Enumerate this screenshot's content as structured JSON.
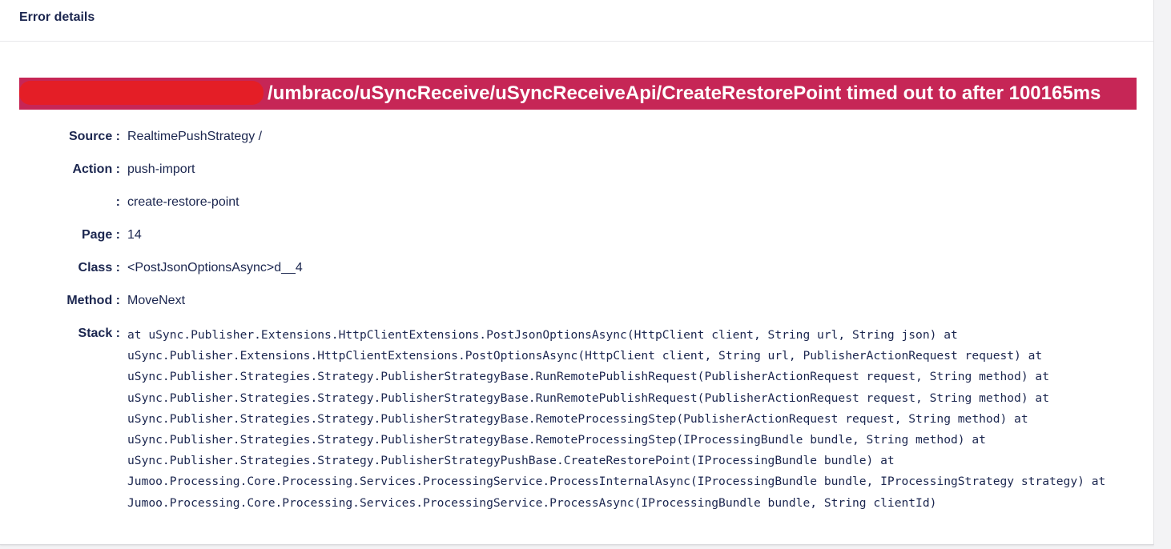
{
  "panel": {
    "title": "Error details"
  },
  "error": {
    "message": "/umbraco/uSyncReceive/uSyncReceiveApi/CreateRestorePoint timed out to after 100165ms",
    "banner_color": "#c62656"
  },
  "details": {
    "source_label": "Source :",
    "source_value": "RealtimePushStrategy /",
    "action_label": "Action :",
    "action_value": "push-import",
    "sub_label": ":",
    "sub_value": "create-restore-point",
    "page_label": "Page :",
    "page_value": "14",
    "class_label": "Class :",
    "class_value": "<PostJsonOptionsAsync>d__4",
    "method_label": "Method :",
    "method_value": "MoveNext",
    "stack_label": "Stack :",
    "stack_value": "at uSync.Publisher.Extensions.HttpClientExtensions.PostJsonOptionsAsync(HttpClient client, String url, String json) at uSync.Publisher.Extensions.HttpClientExtensions.PostOptionsAsync(HttpClient client, String url, PublisherActionRequest request) at uSync.Publisher.Strategies.Strategy.PublisherStrategyBase.RunRemotePublishRequest(PublisherActionRequest request, String method) at uSync.Publisher.Strategies.Strategy.PublisherStrategyBase.RunRemotePublishRequest(PublisherActionRequest request, String method) at uSync.Publisher.Strategies.Strategy.PublisherStrategyBase.RemoteProcessingStep(PublisherActionRequest request, String method) at uSync.Publisher.Strategies.Strategy.PublisherStrategyBase.RemoteProcessingStep(IProcessingBundle bundle, String method) at uSync.Publisher.Strategies.Strategy.PublisherStrategyPushBase.CreateRestorePoint(IProcessingBundle bundle) at Jumoo.Processing.Core.Processing.Services.ProcessingService.ProcessInternalAsync(IProcessingBundle bundle, IProcessingStrategy strategy) at Jumoo.Processing.Core.Processing.Services.ProcessingService.ProcessAsync(IProcessingBundle bundle, String clientId)"
  }
}
